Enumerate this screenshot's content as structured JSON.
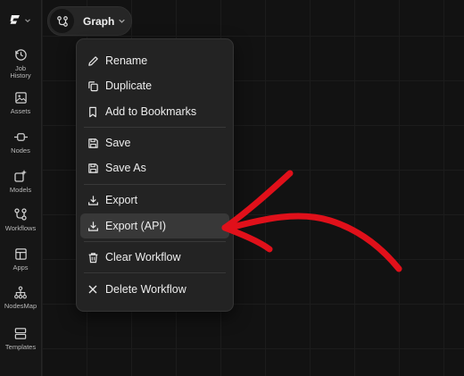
{
  "tab": {
    "label": "Graph"
  },
  "sidebar": {
    "items": [
      {
        "id": "job-history",
        "label": "Job\nHistory"
      },
      {
        "id": "assets",
        "label": "Assets"
      },
      {
        "id": "nodes",
        "label": "Nodes"
      },
      {
        "id": "models",
        "label": "Models"
      },
      {
        "id": "workflows",
        "label": "Workflows"
      },
      {
        "id": "apps",
        "label": "Apps"
      },
      {
        "id": "nodesmap",
        "label": "NodesMap"
      },
      {
        "id": "templates",
        "label": "Templates"
      }
    ]
  },
  "menu": {
    "items": [
      {
        "label": "Rename",
        "icon": "pencil-icon"
      },
      {
        "label": "Duplicate",
        "icon": "copy-icon"
      },
      {
        "label": "Add to Bookmarks",
        "icon": "bookmark-icon"
      },
      {
        "label": "Save",
        "icon": "save-icon"
      },
      {
        "label": "Save As",
        "icon": "save-as-icon"
      },
      {
        "label": "Export",
        "icon": "download-icon"
      },
      {
        "label": "Export (API)",
        "icon": "download-icon",
        "highlighted": true
      },
      {
        "label": "Clear Workflow",
        "icon": "trash-icon"
      },
      {
        "label": "Delete Workflow",
        "icon": "close-icon"
      }
    ]
  },
  "colors": {
    "annotation_arrow": "#e0101a",
    "menu_bg": "#232323",
    "highlight_bg": "#383838"
  }
}
